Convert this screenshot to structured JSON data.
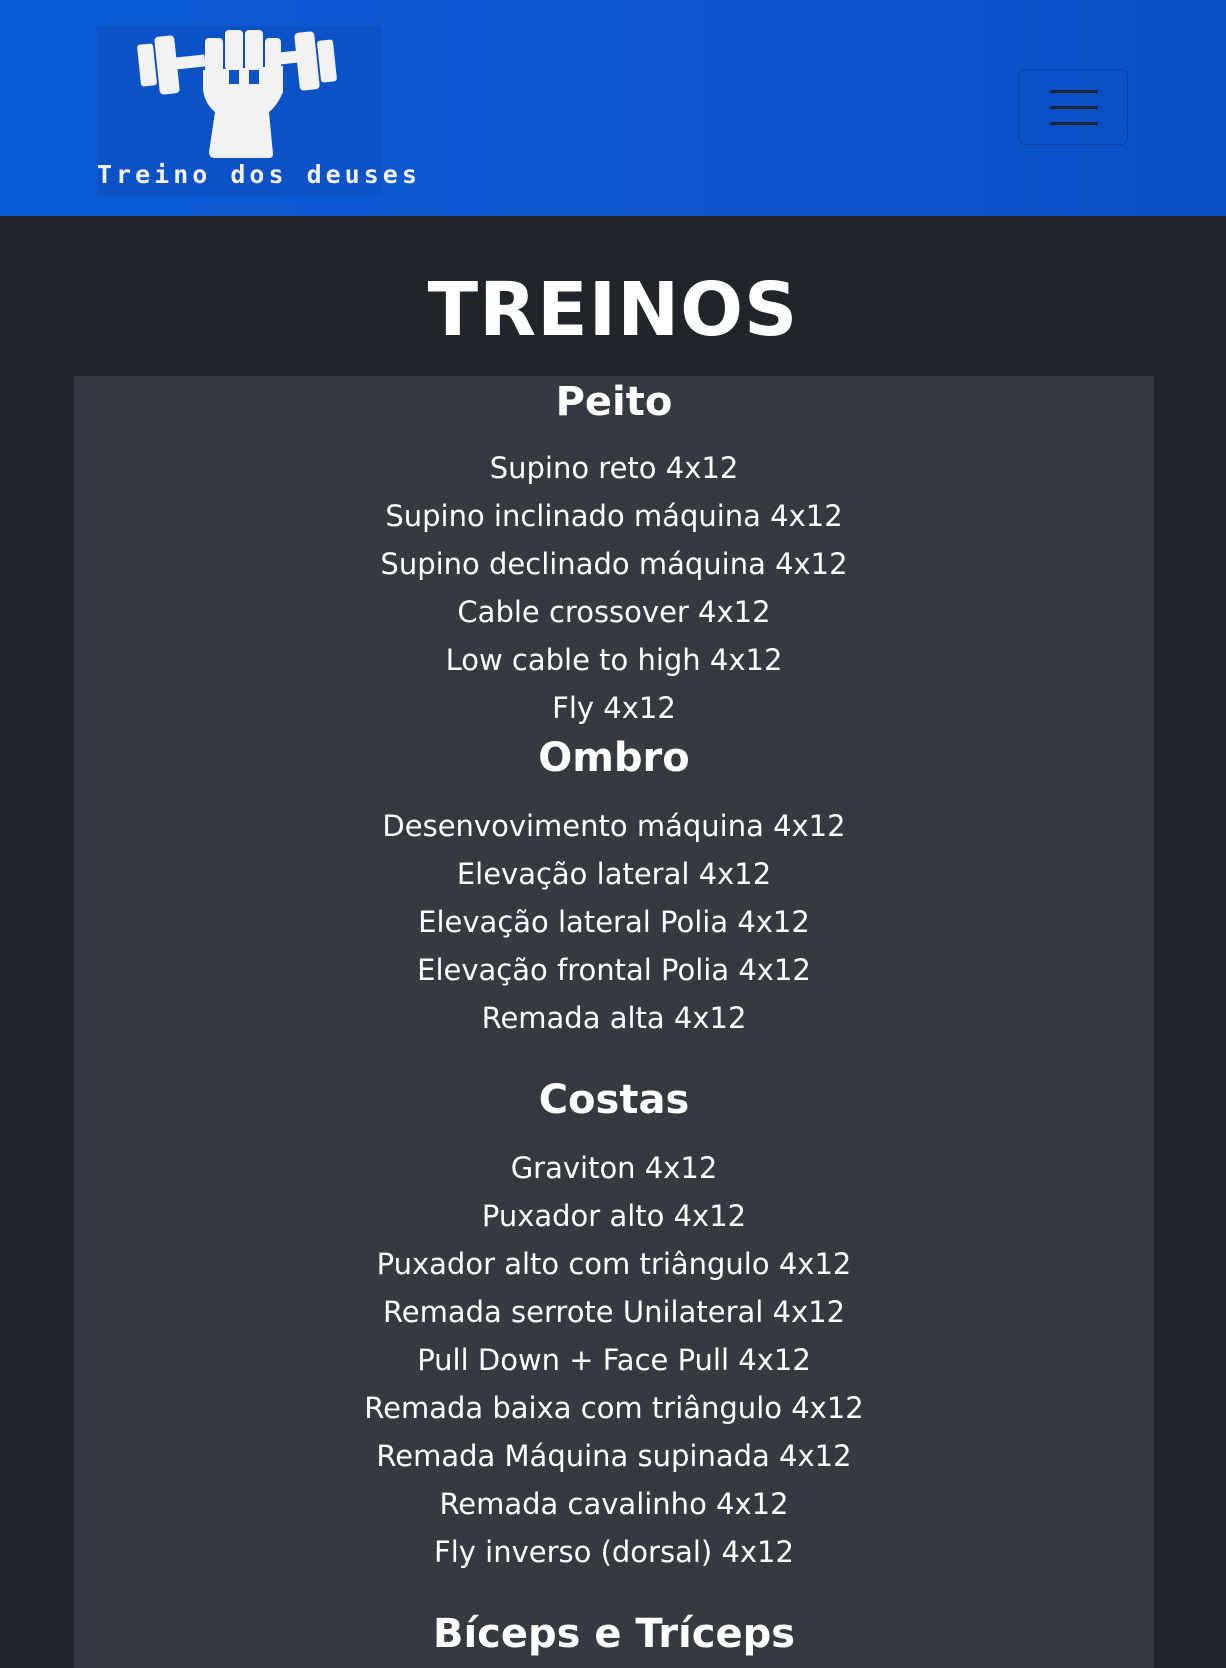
{
  "header": {
    "brand_text": "Treino dos deuses",
    "logo_icon": "fist-dumbbell-icon",
    "menu_icon": "hamburger-icon",
    "background_color": "#0b5bd4"
  },
  "main": {
    "title": "TREINOS",
    "groups": [
      {
        "name": "Peito",
        "exercises": [
          "Supino reto 4x12",
          "Supino inclinado máquina 4x12",
          "Supino declinado máquina 4x12",
          "Cable crossover 4x12",
          "Low cable to high 4x12",
          "Fly 4x12"
        ]
      },
      {
        "name": "Ombro",
        "exercises": [
          "Desenvovimento máquina 4x12",
          "Elevação lateral 4x12",
          "Elevação lateral Polia 4x12",
          "Elevação frontal Polia 4x12",
          "Remada alta 4x12"
        ]
      },
      {
        "name": "Costas",
        "exercises": [
          "Graviton 4x12",
          "Puxador alto 4x12",
          "Puxador alto com triângulo 4x12",
          "Remada serrote Unilateral 4x12",
          "Pull Down + Face Pull 4x12",
          "Remada baixa com triângulo 4x12",
          "Remada Máquina supinada 4x12",
          "Remada cavalinho 4x12",
          "Fly inverso (dorsal) 4x12"
        ]
      },
      {
        "name": "Bíceps e Tríceps",
        "exercises": []
      }
    ]
  },
  "colors": {
    "page_background": "#212529",
    "panel_background": "#343a40",
    "text": "#ffffff"
  }
}
